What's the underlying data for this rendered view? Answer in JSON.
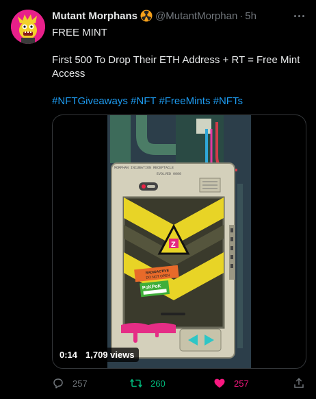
{
  "tweet": {
    "author_name": "Mutant Morphans",
    "handle": "@MutantMorphan",
    "separator": "·",
    "time": "5h",
    "title_line": "FREE MINT",
    "body_line": "First 500 To Drop Their ETH Address + RT = Free Mint Access",
    "hashtags": "#NFTGiveaways #NFT #FreeMints #NFTs"
  },
  "media": {
    "video_time": "0:14",
    "views": "1,709 views",
    "device_header": "MORPHAN INCUBATION RECEPTACLE",
    "device_subheader": "EVOLVED 0000",
    "sticker1_line1": "RADIOACTIVE",
    "sticker1_line2": "DO NOT OPEN",
    "sticker2": "PoKPoK"
  },
  "actions": {
    "replies": "257",
    "retweets": "260",
    "likes": "257"
  },
  "colors": {
    "retweet_green": "#00ba7c",
    "like_pink": "#f91880",
    "link_blue": "#1d9bf0",
    "avatar_pink": "#e8208a"
  }
}
